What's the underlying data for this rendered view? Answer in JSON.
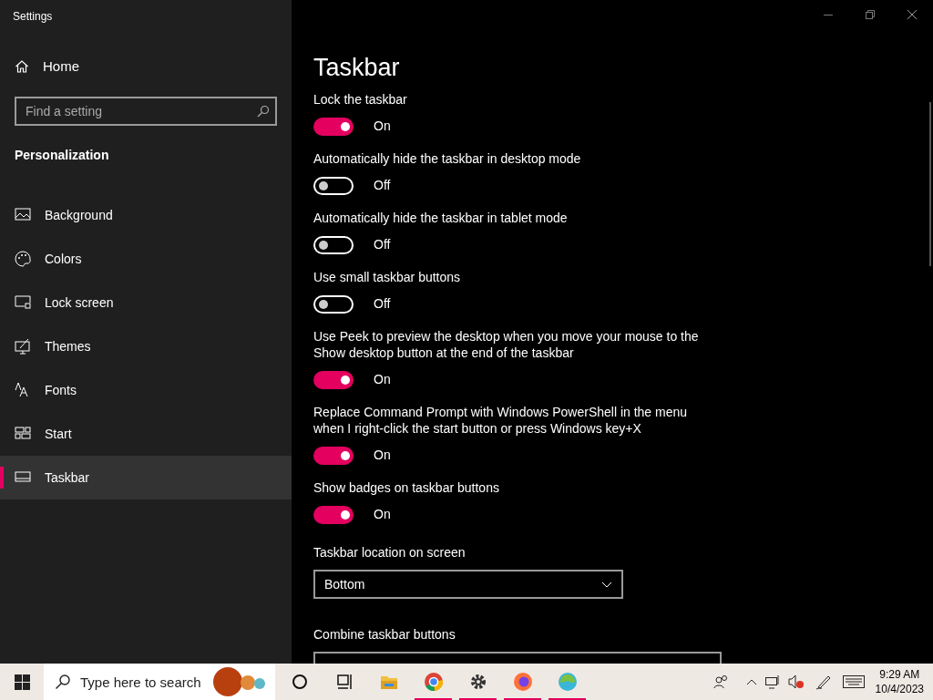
{
  "window": {
    "title": "Settings"
  },
  "sidebar": {
    "home": "Home",
    "search": {
      "placeholder": "Find a setting"
    },
    "section": "Personalization",
    "items": [
      {
        "label": "Background",
        "selected": false
      },
      {
        "label": "Colors",
        "selected": false
      },
      {
        "label": "Lock screen",
        "selected": false
      },
      {
        "label": "Themes",
        "selected": false
      },
      {
        "label": "Fonts",
        "selected": false
      },
      {
        "label": "Start",
        "selected": false
      },
      {
        "label": "Taskbar",
        "selected": true
      }
    ]
  },
  "page": {
    "title": "Taskbar",
    "settings": [
      {
        "kind": "toggle",
        "label": "Lock the taskbar",
        "on": true,
        "state": "On"
      },
      {
        "kind": "toggle",
        "label": "Automatically hide the taskbar in desktop mode",
        "on": false,
        "state": "Off"
      },
      {
        "kind": "toggle",
        "label": "Automatically hide the taskbar in tablet mode",
        "on": false,
        "state": "Off"
      },
      {
        "kind": "toggle",
        "label": "Use small taskbar buttons",
        "on": false,
        "state": "Off"
      },
      {
        "kind": "toggle",
        "label": "Use Peek to preview the desktop when you move your mouse to the Show desktop button at the end of the taskbar",
        "on": true,
        "state": "On"
      },
      {
        "kind": "toggle",
        "label": "Replace Command Prompt with Windows PowerShell in the menu when I right-click the start button or press Windows key+X",
        "on": true,
        "state": "On"
      },
      {
        "kind": "toggle",
        "label": "Show badges on taskbar buttons",
        "on": true,
        "state": "On"
      },
      {
        "kind": "dropdown",
        "label": "Taskbar location on screen",
        "value": "Bottom"
      },
      {
        "kind": "dropdown",
        "label": "Combine taskbar buttons"
      }
    ]
  },
  "taskbar": {
    "search": {
      "placeholder": "Type here to search"
    },
    "apps": [
      {
        "running": false
      },
      {
        "running": false
      },
      {
        "running": false
      },
      {
        "running": true
      },
      {
        "running": true
      },
      {
        "running": true
      },
      {
        "running": true
      }
    ],
    "time": "9:29 AM",
    "date": "10/4/2023"
  }
}
